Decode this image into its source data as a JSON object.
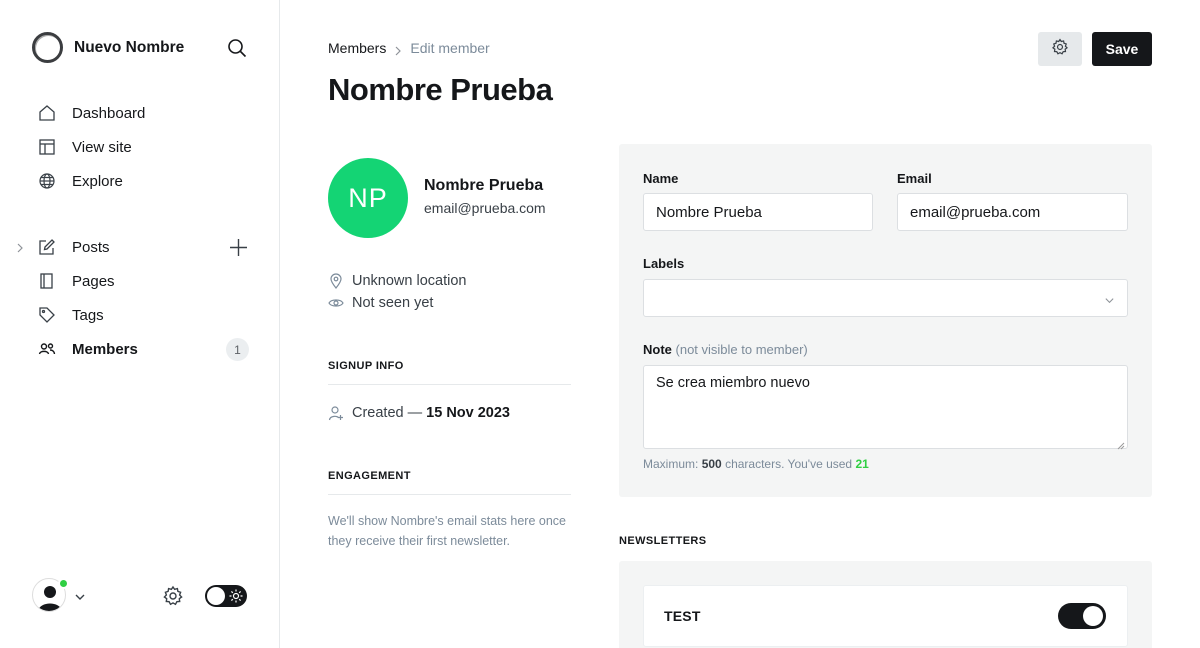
{
  "sidebar": {
    "brand_name": "Nuevo Nombre",
    "nav_top": [
      {
        "label": "Dashboard",
        "icon": "home-icon"
      },
      {
        "label": "View site",
        "icon": "view-site-icon"
      },
      {
        "label": "Explore",
        "icon": "globe-icon"
      }
    ],
    "nav_content": [
      {
        "label": "Posts",
        "icon": "pencil-icon"
      },
      {
        "label": "Pages",
        "icon": "pages-icon"
      },
      {
        "label": "Tags",
        "icon": "tag-icon"
      },
      {
        "label": "Members",
        "icon": "members-icon",
        "count": "1",
        "active": true
      }
    ]
  },
  "header": {
    "breadcrumb_parent": "Members",
    "breadcrumb_current": "Edit member",
    "title": "Nombre Prueba",
    "save_label": "Save"
  },
  "profile": {
    "initials": "NP",
    "avatar_color": "#14d474",
    "name": "Nombre Prueba",
    "email": "email@prueba.com",
    "location": "Unknown location",
    "last_seen": "Not seen yet",
    "signup_heading": "SIGNUP INFO",
    "created_prefix": "Created —",
    "created_date": "15 Nov 2023",
    "engagement_heading": "ENGAGEMENT",
    "engagement_text": "We'll show Nombre's email stats here once they receive their first newsletter."
  },
  "form": {
    "name_label": "Name",
    "name_value": "Nombre Prueba",
    "email_label": "Email",
    "email_value": "email@prueba.com",
    "labels_label": "Labels",
    "labels_value": "",
    "note_label": "Note",
    "note_sublabel": "(not visible to member)",
    "note_value": "Se crea miembro nuevo",
    "hint_prefix": "Maximum:",
    "hint_max": "500",
    "hint_middle": "characters. You've used",
    "hint_used": "21"
  },
  "newsletters": {
    "heading": "NEWSLETTERS",
    "items": [
      {
        "name": "TEST",
        "subscribed": true
      }
    ]
  },
  "colors": {
    "accent_green": "#30cf43",
    "dark": "#15171a"
  }
}
